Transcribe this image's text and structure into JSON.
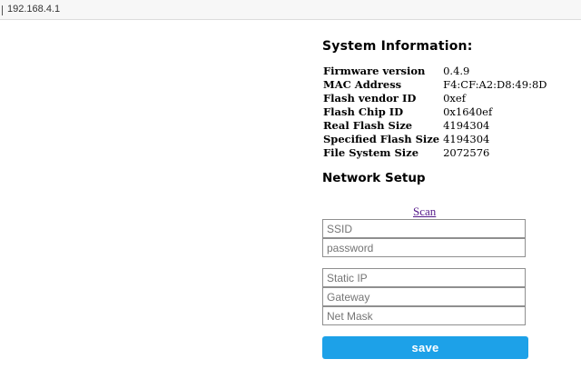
{
  "browser": {
    "url": "192.168.4.1"
  },
  "system": {
    "title": "System Information:",
    "rows": [
      {
        "label": "Firmware version",
        "value": "0.4.9"
      },
      {
        "label": "MAC Address",
        "value": "F4:CF:A2:D8:49:8D"
      },
      {
        "label": "Flash vendor ID",
        "value": "0xef"
      },
      {
        "label": "Flash Chip ID",
        "value": "0x1640ef"
      },
      {
        "label": "Real Flash Size",
        "value": "4194304"
      },
      {
        "label": "Specified Flash Size",
        "value": "4194304"
      },
      {
        "label": "File System Size",
        "value": "2072576"
      }
    ]
  },
  "network": {
    "title": "Network Setup",
    "scan_label": "Scan",
    "ssid": {
      "placeholder": "SSID",
      "value": ""
    },
    "password": {
      "placeholder": "password",
      "value": ""
    },
    "static_ip": {
      "placeholder": "Static IP",
      "value": ""
    },
    "gateway": {
      "placeholder": "Gateway",
      "value": ""
    },
    "netmask": {
      "placeholder": "Net Mask",
      "value": ""
    },
    "save_label": "save"
  },
  "colors": {
    "save_button": "#1da1e8",
    "link": "#551a8b"
  }
}
